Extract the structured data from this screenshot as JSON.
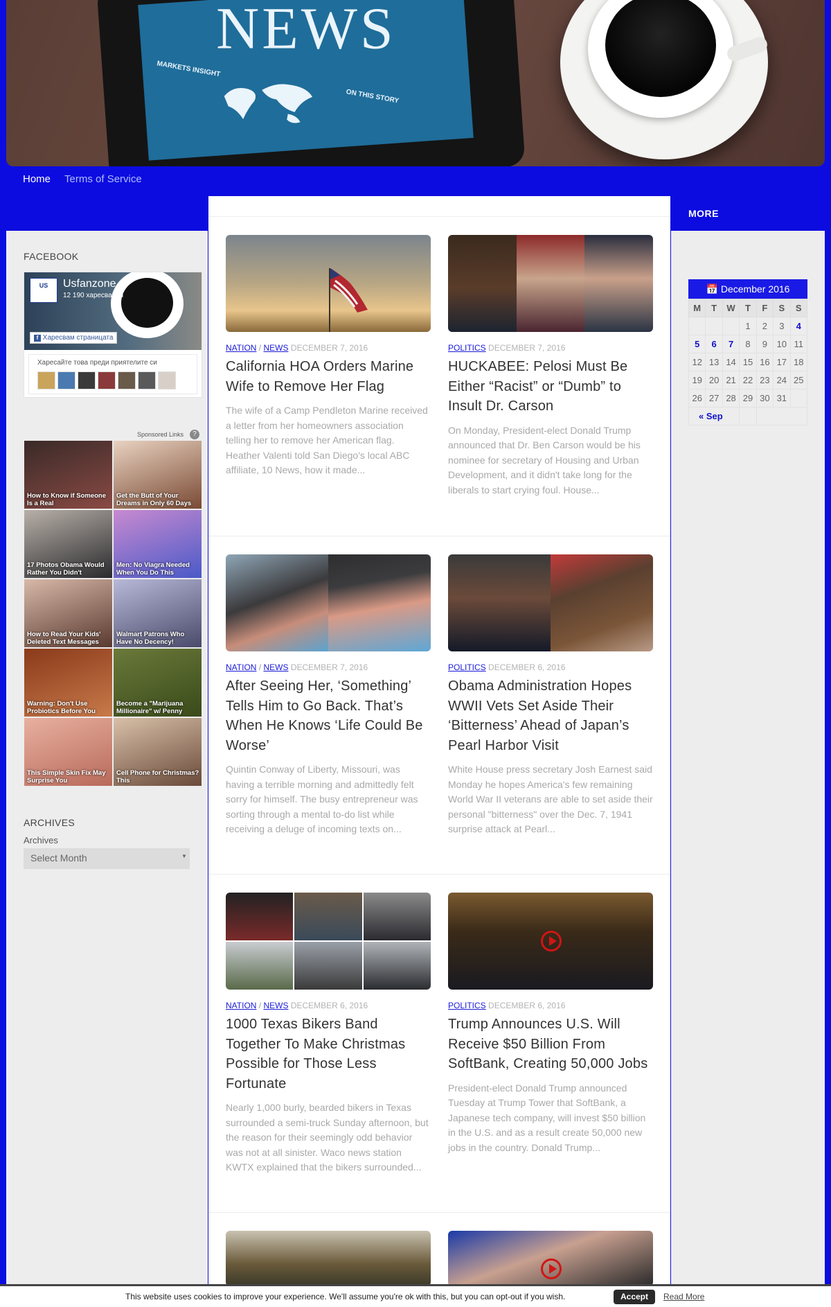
{
  "header": {
    "headline": "NEWS",
    "markets": "MARKETS INSIGHT",
    "story": "ON THIS STORY"
  },
  "nav": [
    {
      "label": "Home"
    },
    {
      "label": "Terms of Service"
    }
  ],
  "more_label": "MORE",
  "facebook": {
    "title": "FACEBOOK",
    "page_name": "Usfanzone",
    "likes": "12 190 харесвания",
    "like_button": "Харесвам страницата",
    "friends_prompt": "Харесайте това преди приятелите си",
    "logo_text": "US"
  },
  "sponsored": {
    "label": "Sponsored Links",
    "help": "?",
    "ads": [
      {
        "caption": "How to Know if Someone Is a Real"
      },
      {
        "caption": "Get the Butt of Your Dreams in Only 60 Days"
      },
      {
        "caption": "17 Photos Obama Would Rather You Didn't"
      },
      {
        "caption": "Men: No Viagra Needed When You Do This"
      },
      {
        "caption": "How to Read Your Kids' Deleted Text Messages"
      },
      {
        "caption": "Walmart Patrons Who Have No Decency!"
      },
      {
        "caption": "Warning: Don't Use Probiotics Before You"
      },
      {
        "caption": "Become a \"Marijuana Millionaire\" w/ Penny"
      },
      {
        "caption": "This Simple Skin Fix May Surprise You"
      },
      {
        "caption": "Cell Phone for Christmas? This"
      }
    ]
  },
  "archives": {
    "title": "ARCHIVES",
    "label": "Archives",
    "select_value": "Select Month"
  },
  "calendar": {
    "caption": "December 2016",
    "days": [
      "M",
      "T",
      "W",
      "T",
      "F",
      "S",
      "S"
    ],
    "weeks": [
      [
        "",
        "",
        "",
        "1",
        "2",
        "3",
        "4"
      ],
      [
        "5",
        "6",
        "7",
        "8",
        "9",
        "10",
        "11"
      ],
      [
        "12",
        "13",
        "14",
        "15",
        "16",
        "17",
        "18"
      ],
      [
        "19",
        "20",
        "21",
        "22",
        "23",
        "24",
        "25"
      ],
      [
        "26",
        "27",
        "28",
        "29",
        "30",
        "31",
        ""
      ]
    ],
    "linked_days": [
      "4",
      "5",
      "6",
      "7"
    ],
    "prev": "« Sep"
  },
  "posts": [
    {
      "cats": [
        "NATION",
        "NEWS"
      ],
      "date": "DECEMBER 7, 2016",
      "title": "California HOA Orders Marine Wife to Remove Her Flag",
      "excerpt": "The wife of a Camp Pendleton Marine received a letter from her homeowners association telling her to remove her American flag. Heather Valenti told San Diego's local ABC affiliate, 10 News, how it made..."
    },
    {
      "cats": [
        "POLITICS"
      ],
      "date": "DECEMBER 7, 2016",
      "title": "HUCKABEE: Pelosi Must Be Either “Racist” or “Dumb” to Insult Dr. Carson",
      "excerpt": "On Monday, President-elect Donald Trump announced that Dr. Ben Carson would be his nominee for secretary of Housing and Urban Development, and it didn't take long for the liberals to start crying foul. House..."
    },
    {
      "cats": [
        "NATION",
        "NEWS"
      ],
      "date": "DECEMBER 7, 2016",
      "title": "After Seeing Her, ‘Something’ Tells Him to Go Back. That’s When He Knows ‘Life Could Be Worse’",
      "excerpt": "Quintin Conway of Liberty, Missouri, was having a terrible morning and admittedly felt sorry for himself. The busy entrepreneur was sorting through a mental to-do list while receiving a deluge of incoming texts on..."
    },
    {
      "cats": [
        "POLITICS"
      ],
      "date": "DECEMBER 6, 2016",
      "title": "Obama Administration Hopes WWII Vets Set Aside Their ‘Bitterness’ Ahead of Japan’s Pearl Harbor Visit",
      "excerpt": "White House press secretary Josh Earnest said Monday he hopes America's few remaining World War II veterans are able to set aside their personal \"bitterness\" over the Dec. 7, 1941 surprise attack at Pearl..."
    },
    {
      "cats": [
        "NATION",
        "NEWS"
      ],
      "date": "DECEMBER 6, 2016",
      "title": "1000 Texas Bikers Band Together To Make Christmas Possible for Those Less Fortunate",
      "excerpt": "Nearly 1,000 burly, bearded bikers in Texas surrounded a semi-truck Sunday afternoon, but the reason for their seemingly odd behavior was not at all sinister. Waco news station KWTX explained that the bikers surrounded..."
    },
    {
      "cats": [
        "POLITICS"
      ],
      "date": "DECEMBER 6, 2016",
      "title": "Trump Announces U.S. Will Receive $50 Billion From SoftBank, Creating 50,000 Jobs",
      "excerpt": "President-elect Donald Trump announced Tuesday at Trump Tower that SoftBank, a Japanese tech company, will invest $50 billion in the U.S. and as a result create 50,000 new jobs in the country. Donald Trump..."
    }
  ],
  "cookie": {
    "text": "This website uses cookies to improve your experience. We'll assume you're ok with this, but you can opt-out if you wish.",
    "accept": "Accept",
    "read_more": "Read More"
  },
  "colors": {
    "page_background": "#0c0ce0",
    "accent": "#1a1ad8",
    "sidebar_background": "#ededee"
  }
}
